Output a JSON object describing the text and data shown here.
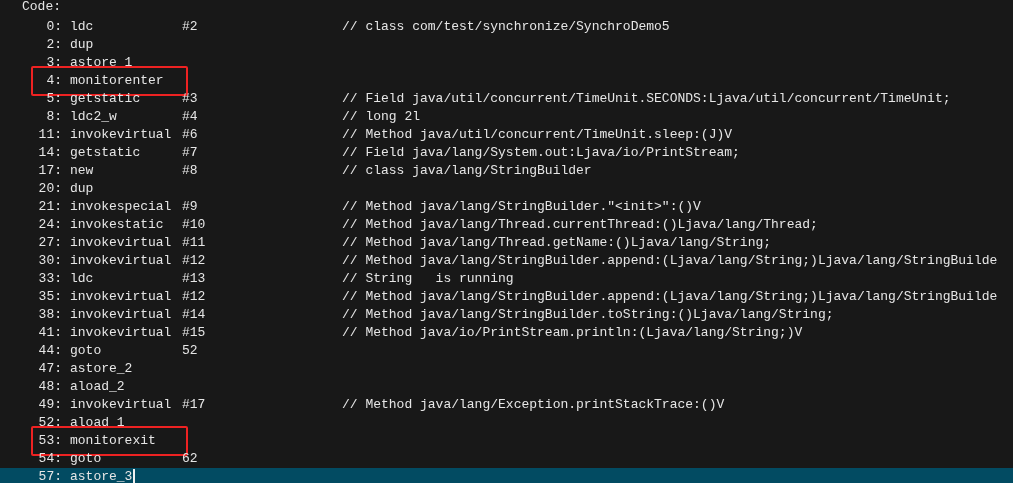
{
  "header": "Code:",
  "rows": [
    {
      "offset": "0:",
      "opcode": "ldc",
      "operand": "#2",
      "comment": "// class com/test/synchronize/SynchroDemo5",
      "boxed": false,
      "selected": false
    },
    {
      "offset": "2:",
      "opcode": "dup",
      "boxed": false,
      "selected": false
    },
    {
      "offset": "3:",
      "opcode": "astore_1",
      "boxed": false,
      "selected": false
    },
    {
      "offset": "4:",
      "opcode": "monitorenter",
      "boxed": true,
      "selected": false
    },
    {
      "offset": "5:",
      "opcode": "getstatic",
      "operand": "#3",
      "comment": "// Field java/util/concurrent/TimeUnit.SECONDS:Ljava/util/concurrent/TimeUnit;",
      "boxed": false,
      "selected": false
    },
    {
      "offset": "8:",
      "opcode": "ldc2_w",
      "operand": "#4",
      "comment": "// long 2l",
      "boxed": false,
      "selected": false
    },
    {
      "offset": "11:",
      "opcode": "invokevirtual",
      "operand": "#6",
      "comment": "// Method java/util/concurrent/TimeUnit.sleep:(J)V",
      "boxed": false,
      "selected": false
    },
    {
      "offset": "14:",
      "opcode": "getstatic",
      "operand": "#7",
      "comment": "// Field java/lang/System.out:Ljava/io/PrintStream;",
      "boxed": false,
      "selected": false
    },
    {
      "offset": "17:",
      "opcode": "new",
      "operand": "#8",
      "comment": "// class java/lang/StringBuilder",
      "boxed": false,
      "selected": false
    },
    {
      "offset": "20:",
      "opcode": "dup",
      "boxed": false,
      "selected": false
    },
    {
      "offset": "21:",
      "opcode": "invokespecial",
      "operand": "#9",
      "comment": "// Method java/lang/StringBuilder.\"<init>\":()V",
      "boxed": false,
      "selected": false
    },
    {
      "offset": "24:",
      "opcode": "invokestatic",
      "operand": "#10",
      "comment": "// Method java/lang/Thread.currentThread:()Ljava/lang/Thread;",
      "boxed": false,
      "selected": false
    },
    {
      "offset": "27:",
      "opcode": "invokevirtual",
      "operand": "#11",
      "comment": "// Method java/lang/Thread.getName:()Ljava/lang/String;",
      "boxed": false,
      "selected": false
    },
    {
      "offset": "30:",
      "opcode": "invokevirtual",
      "operand": "#12",
      "comment": "// Method java/lang/StringBuilder.append:(Ljava/lang/String;)Ljava/lang/StringBuilde",
      "boxed": false,
      "selected": false
    },
    {
      "offset": "33:",
      "opcode": "ldc",
      "operand": "#13",
      "comment": "// String   is running",
      "boxed": false,
      "selected": false
    },
    {
      "offset": "35:",
      "opcode": "invokevirtual",
      "operand": "#12",
      "comment": "// Method java/lang/StringBuilder.append:(Ljava/lang/String;)Ljava/lang/StringBuilde",
      "boxed": false,
      "selected": false
    },
    {
      "offset": "38:",
      "opcode": "invokevirtual",
      "operand": "#14",
      "comment": "// Method java/lang/StringBuilder.toString:()Ljava/lang/String;",
      "boxed": false,
      "selected": false
    },
    {
      "offset": "41:",
      "opcode": "invokevirtual",
      "operand": "#15",
      "comment": "// Method java/io/PrintStream.println:(Ljava/lang/String;)V",
      "boxed": false,
      "selected": false
    },
    {
      "offset": "44:",
      "opcode": "goto",
      "operand": "52",
      "boxed": false,
      "selected": false
    },
    {
      "offset": "47:",
      "opcode": "astore_2",
      "boxed": false,
      "selected": false
    },
    {
      "offset": "48:",
      "opcode": "aload_2",
      "boxed": false,
      "selected": false
    },
    {
      "offset": "49:",
      "opcode": "invokevirtual",
      "operand": "#17",
      "comment": "// Method java/lang/Exception.printStackTrace:()V",
      "boxed": false,
      "selected": false
    },
    {
      "offset": "52:",
      "opcode": "aload_1",
      "boxed": false,
      "selected": false
    },
    {
      "offset": "53:",
      "opcode": "monitorexit",
      "boxed": true,
      "selected": false
    },
    {
      "offset": "54:",
      "opcode": "goto",
      "operand": "62",
      "boxed": false,
      "selected": false
    },
    {
      "offset": "57:",
      "opcode": "astore_3",
      "boxed": false,
      "selected": true
    }
  ]
}
